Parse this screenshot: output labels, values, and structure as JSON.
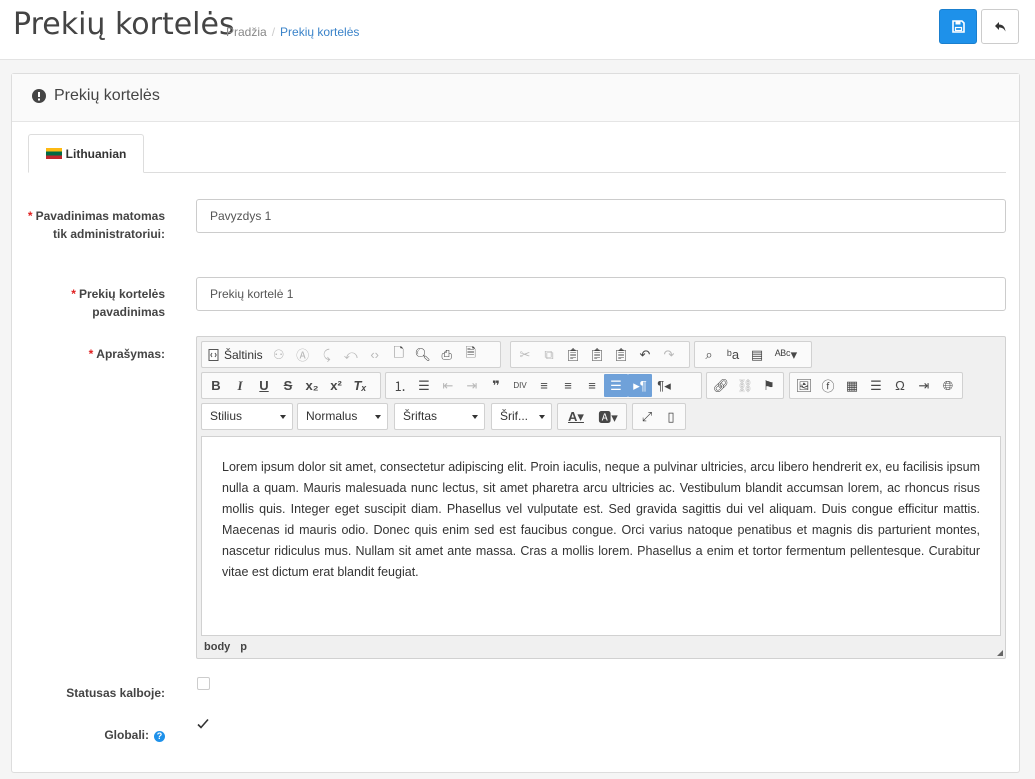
{
  "header": {
    "title": "Prekių kortelės",
    "breadcrumb": [
      {
        "label": "Pradžia"
      },
      {
        "label": "Prekių kortelės"
      }
    ],
    "save_icon": "floppy-disk-icon",
    "back_icon": "reply-arrow-icon"
  },
  "panel": {
    "title": "Prekių kortelės",
    "icon": "exclamation-circle-icon"
  },
  "tabs": [
    {
      "label": "Lithuanian",
      "icon": "lithuania-flag-icon",
      "active": true
    }
  ],
  "form": {
    "admin_name": {
      "label": "Pavadinimas matomas tik administratoriui:",
      "required": "*",
      "value": "Pavyzdys 1"
    },
    "card_name": {
      "label": "Prekių kortelės pavadinimas",
      "required": "*",
      "value": "Prekių kortelė 1"
    },
    "description": {
      "label": "Aprašymas:",
      "required": "*",
      "source_label": "Šaltinis",
      "styles": [
        "Stilius",
        "Normalus",
        "Šriftas",
        "Šrif..."
      ],
      "body": "Lorem ipsum dolor sit amet, consectetur adipiscing elit. Proin iaculis, neque a pulvinar ultricies, arcu libero hendrerit ex, eu facilisis ipsum nulla a quam. Mauris malesuada nunc lectus, sit amet pharetra arcu ultricies ac. Vestibulum blandit accumsan lorem, ac rhoncus risus mollis quis. Integer eget suscipit diam. Phasellus vel vulputate est. Sed gravida sagittis dui vel aliquam. Duis congue efficitur mattis. Maecenas id mauris odio. Donec quis enim sed est faucibus congue. Orci varius natoque penatibus et magnis dis parturient montes, nascetur ridiculus mus. Nullam sit amet ante massa. Cras a mollis lorem. Phasellus a enim et tortor fermentum pellentesque. Curabitur vitae est dictum erat blandit feugiat.",
      "path": [
        "body",
        "p"
      ]
    },
    "status": {
      "label": "Statusas kalboje:",
      "checked": false
    },
    "global": {
      "label": "Globali:",
      "checked": true,
      "help_glyph": "?"
    }
  },
  "colors": {
    "primary": "#1e91ea",
    "required": "#e02020",
    "link": "#3a83c9",
    "active_tool": "#6fa1d9"
  }
}
